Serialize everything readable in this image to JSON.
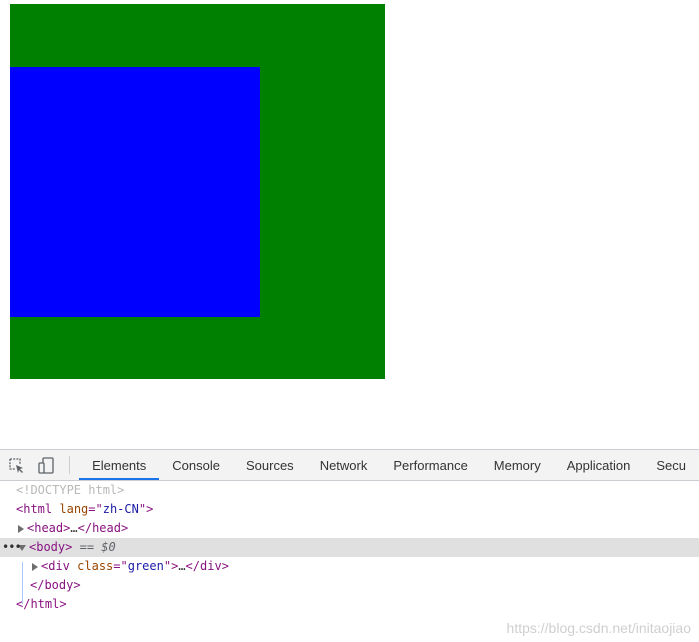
{
  "page": {
    "outer_div_color": "#008000",
    "inner_div_color": "#0000ff"
  },
  "devtools": {
    "toolbar": {
      "inspect_icon": "element-picker-icon",
      "device_icon": "device-toolbar-icon",
      "tabs": [
        {
          "label": "Elements",
          "active": true
        },
        {
          "label": "Console"
        },
        {
          "label": "Sources"
        },
        {
          "label": "Network"
        },
        {
          "label": "Performance"
        },
        {
          "label": "Memory"
        },
        {
          "label": "Application"
        },
        {
          "label": "Secu"
        }
      ]
    },
    "dom": {
      "doctype": "<!DOCTYPE html>",
      "html_open_tag": "html",
      "html_lang_attr": "lang",
      "html_lang_value": "zh-CN",
      "head_tag": "head",
      "head_collapsed": "…",
      "body_tag": "body",
      "body_marker_eq": "==",
      "body_marker_var": "$0",
      "div_tag": "div",
      "div_attr": "class",
      "div_attr_value": "green",
      "div_collapsed": "…",
      "body_close": "body",
      "html_close": "html",
      "row_menu": "•••"
    }
  },
  "watermark": "https://blog.csdn.net/initaojiao"
}
